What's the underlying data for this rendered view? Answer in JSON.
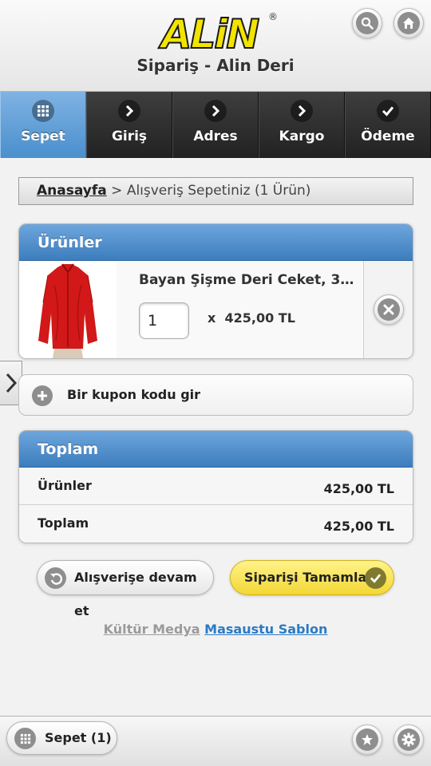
{
  "header": {
    "logo_text": "ALiN",
    "logo_mark": "®",
    "title": "Sipariş - Alin Deri",
    "search_icon": "search-icon",
    "home_icon": "home-icon"
  },
  "nav": {
    "tabs": [
      {
        "label": "Sepet",
        "icon": "grid-icon",
        "active": true
      },
      {
        "label": "Giriş",
        "icon": "chevron-right-icon"
      },
      {
        "label": "Adres",
        "icon": "chevron-right-icon"
      },
      {
        "label": "Kargo",
        "icon": "chevron-right-icon"
      },
      {
        "label": "Ödeme",
        "icon": "check-icon"
      }
    ]
  },
  "breadcrumb": {
    "home": "Anasayfa",
    "separator": ">",
    "current": "Alışveriş Sepetiniz (1 Ürün)"
  },
  "products_panel": {
    "title": "Ürünler",
    "items": [
      {
        "name": "Bayan Şişme Deri Ceket, 38 ...",
        "quantity": "1",
        "multiplier": "x",
        "price": "425,00 TL"
      }
    ]
  },
  "coupon": {
    "label": "Bir kupon kodu gir"
  },
  "totals_panel": {
    "title": "Toplam",
    "rows": [
      {
        "label": "Ürünler",
        "value": "425,00 TL"
      },
      {
        "label": "Toplam",
        "value": "425,00 TL"
      }
    ]
  },
  "actions": {
    "continue_label": "Alışverişe devam et",
    "complete_label": "Siparişi Tamamla"
  },
  "footer": {
    "muted_text": "Kültür Medya",
    "link_text": "Masaustu Sablon"
  },
  "bottom_bar": {
    "cart_label": "Sepet (1)"
  },
  "colors": {
    "accent_blue": "#4a8fcd",
    "logo_yellow": "#f3e400",
    "complete_yellow": "#f3d734",
    "link_blue": "#2b7bc4"
  }
}
